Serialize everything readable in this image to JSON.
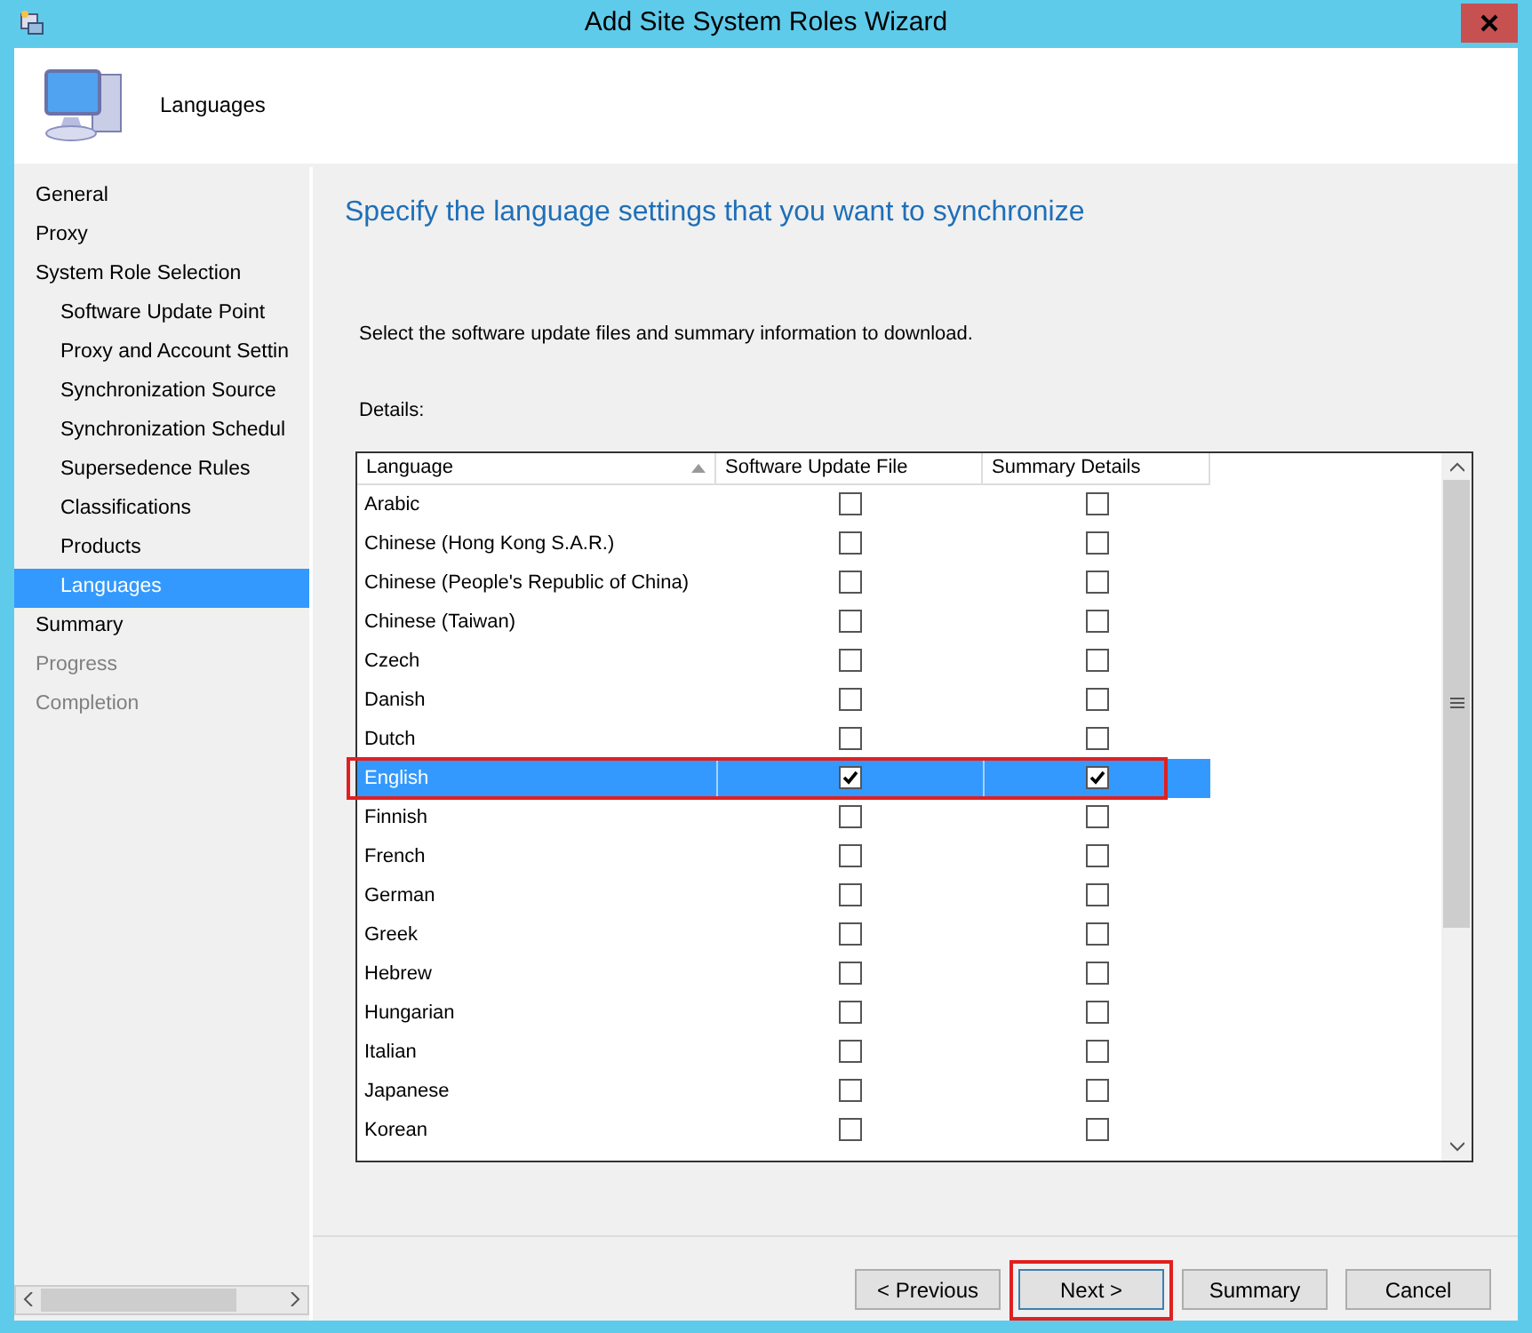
{
  "window": {
    "title": "Add Site System Roles Wizard"
  },
  "header": {
    "title": "Languages"
  },
  "sidebar": {
    "items": [
      {
        "label": "General",
        "selected": false,
        "disabled": false
      },
      {
        "label": "Proxy",
        "selected": false,
        "disabled": false
      },
      {
        "label": "System Role Selection",
        "selected": false,
        "disabled": false,
        "children": [
          {
            "label": "Software Update Point",
            "selected": false,
            "disabled": false
          },
          {
            "label": "Proxy and Account Settin",
            "selected": false,
            "disabled": false
          },
          {
            "label": "Synchronization Source",
            "selected": false,
            "disabled": false
          },
          {
            "label": "Synchronization Schedul",
            "selected": false,
            "disabled": false
          },
          {
            "label": "Supersedence Rules",
            "selected": false,
            "disabled": false
          },
          {
            "label": "Classifications",
            "selected": false,
            "disabled": false
          },
          {
            "label": "Products",
            "selected": false,
            "disabled": false
          },
          {
            "label": "Languages",
            "selected": true,
            "disabled": false
          }
        ]
      },
      {
        "label": "Summary",
        "selected": false,
        "disabled": false
      },
      {
        "label": "Progress",
        "selected": false,
        "disabled": true
      },
      {
        "label": "Completion",
        "selected": false,
        "disabled": true
      }
    ]
  },
  "content": {
    "heading": "Specify the language settings that you want to synchronize",
    "instruction": "Select the software update files and summary information to download.",
    "details_label": "Details:"
  },
  "table": {
    "columns": [
      "Language",
      "Software Update File",
      "Summary Details"
    ],
    "rows": [
      {
        "language": "Arabic",
        "update_file": false,
        "summary": false,
        "selected": false,
        "highlighted": false
      },
      {
        "language": "Chinese (Hong Kong S.A.R.)",
        "update_file": false,
        "summary": false,
        "selected": false,
        "highlighted": false
      },
      {
        "language": "Chinese (People's Republic of China)",
        "update_file": false,
        "summary": false,
        "selected": false,
        "highlighted": false
      },
      {
        "language": "Chinese (Taiwan)",
        "update_file": false,
        "summary": false,
        "selected": false,
        "highlighted": false
      },
      {
        "language": "Czech",
        "update_file": false,
        "summary": false,
        "selected": false,
        "highlighted": false
      },
      {
        "language": "Danish",
        "update_file": false,
        "summary": false,
        "selected": false,
        "highlighted": false
      },
      {
        "language": "Dutch",
        "update_file": false,
        "summary": false,
        "selected": false,
        "highlighted": false
      },
      {
        "language": "English",
        "update_file": true,
        "summary": true,
        "selected": true,
        "highlighted": true
      },
      {
        "language": "Finnish",
        "update_file": false,
        "summary": false,
        "selected": false,
        "highlighted": false
      },
      {
        "language": "French",
        "update_file": false,
        "summary": false,
        "selected": false,
        "highlighted": false
      },
      {
        "language": "German",
        "update_file": false,
        "summary": false,
        "selected": false,
        "highlighted": false
      },
      {
        "language": "Greek",
        "update_file": false,
        "summary": false,
        "selected": false,
        "highlighted": false
      },
      {
        "language": "Hebrew",
        "update_file": false,
        "summary": false,
        "selected": false,
        "highlighted": false
      },
      {
        "language": "Hungarian",
        "update_file": false,
        "summary": false,
        "selected": false,
        "highlighted": false
      },
      {
        "language": "Italian",
        "update_file": false,
        "summary": false,
        "selected": false,
        "highlighted": false
      },
      {
        "language": "Japanese",
        "update_file": false,
        "summary": false,
        "selected": false,
        "highlighted": false
      },
      {
        "language": "Korean",
        "update_file": false,
        "summary": false,
        "selected": false,
        "highlighted": false
      }
    ]
  },
  "buttons": [
    {
      "label": "< Previous",
      "highlighted": false
    },
    {
      "label": "Next >",
      "highlighted": true
    },
    {
      "label": "Summary",
      "highlighted": false
    },
    {
      "label": "Cancel",
      "highlighted": false
    }
  ]
}
